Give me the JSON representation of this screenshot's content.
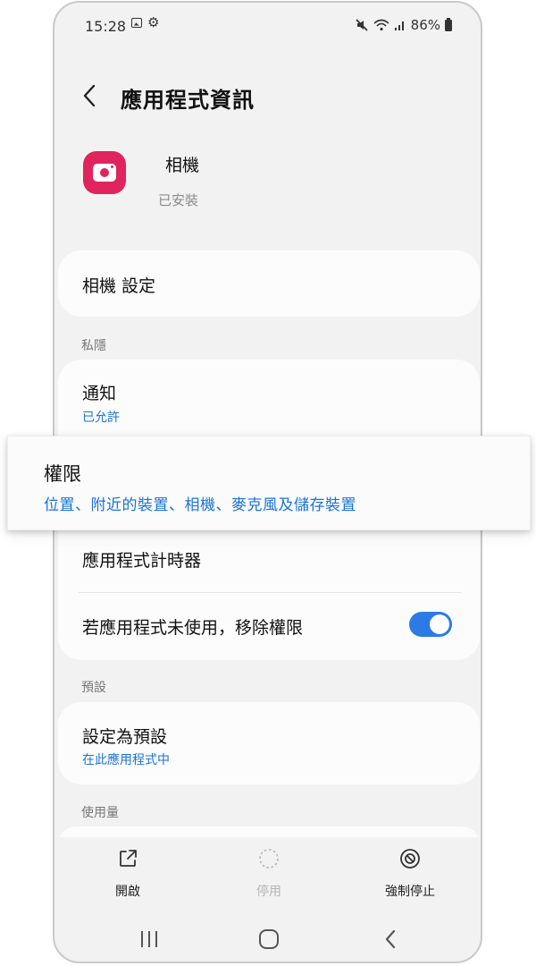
{
  "status_bar": {
    "time": "15:28",
    "battery": "86%"
  },
  "header": {
    "title": "應用程式資訊"
  },
  "app": {
    "name": "相機",
    "install_status": "已安裝"
  },
  "settings_row": {
    "label": "相機 設定"
  },
  "privacy": {
    "section_label": "私隱",
    "notifications": {
      "title": "通知",
      "subtitle": "已允許"
    },
    "permissions": {
      "title": "權限",
      "subtitle": "位置、附近的裝置、相機、麥克風及儲存裝置"
    },
    "app_timer": {
      "title": "應用程式計時器"
    },
    "remove_permissions": {
      "title": "若應用程式未使用，移除權限",
      "enabled": true
    }
  },
  "defaults": {
    "section_label": "預設",
    "set_default": {
      "title": "設定為預設",
      "subtitle": "在此應用程式中"
    }
  },
  "usage": {
    "section_label": "使用量"
  },
  "bottom_actions": {
    "open": "開啟",
    "disable": "停用",
    "force_stop": "強制停止"
  },
  "colors": {
    "accent": "#1a73d8",
    "toggle_on": "#2c7be5",
    "app_icon": "#e0245e"
  },
  "icons": {
    "back": "chevron-left-icon",
    "open": "open-external-icon",
    "disable": "dashed-circle-icon",
    "force_stop": "stop-circle-icon",
    "nav_recents": "recents-icon",
    "nav_home": "home-icon",
    "nav_back": "back-icon"
  }
}
